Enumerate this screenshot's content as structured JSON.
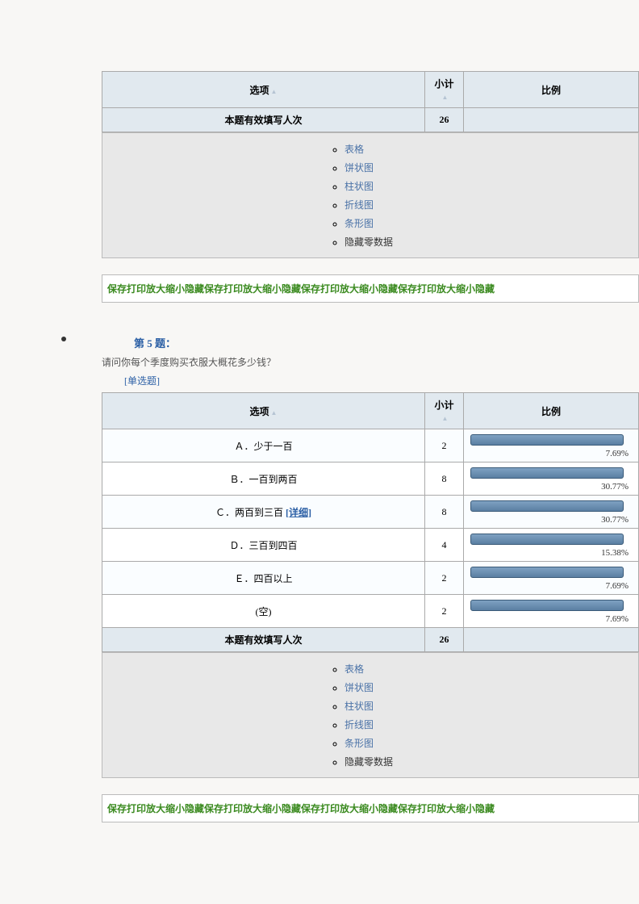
{
  "headers": {
    "option": "选项",
    "count": "小计",
    "ratio": "比例"
  },
  "first_summary": {
    "label": "本题有效填写人次",
    "count": 26
  },
  "chart_options": [
    "表格",
    "饼状图",
    "柱状图",
    "折线图",
    "条形图",
    "隐藏零数据"
  ],
  "action_text": "保存打印放大缩小隐藏保存打印放大缩小隐藏保存打印放大缩小隐藏保存打印放大缩小隐藏",
  "q5": {
    "label": "第 5 题：",
    "text": "请问你每个季度购买衣服大概花多少钱？",
    "type": "[单选题]",
    "rows": [
      {
        "option": "Ａ．少于一百",
        "count": 2,
        "pct": "7.69%"
      },
      {
        "option": "Ｂ．一百到两百",
        "count": 8,
        "pct": "30.77%"
      },
      {
        "option_prefix": "Ｃ．两百到三百  ",
        "detail": "[详细]",
        "count": 8,
        "pct": "30.77%"
      },
      {
        "option": "Ｄ．三百到四百",
        "count": 4,
        "pct": "15.38%"
      },
      {
        "option": "Ｅ．四百以上",
        "count": 2,
        "pct": "7.69%"
      },
      {
        "option": "(空)",
        "count": 2,
        "pct": "7.69%"
      }
    ],
    "summary": {
      "label": "本题有效填写人次",
      "count": 26
    }
  },
  "chart_data": {
    "type": "table",
    "title": "请问你每个季度购买衣服大概花多少钱？",
    "categories": [
      "少于一百",
      "一百到两百",
      "两百到三百",
      "三百到四百",
      "四百以上",
      "(空)"
    ],
    "values": [
      2,
      8,
      8,
      4,
      2,
      2
    ],
    "percentages": [
      7.69,
      30.77,
      30.77,
      15.38,
      7.69,
      7.69
    ],
    "total": 26
  }
}
